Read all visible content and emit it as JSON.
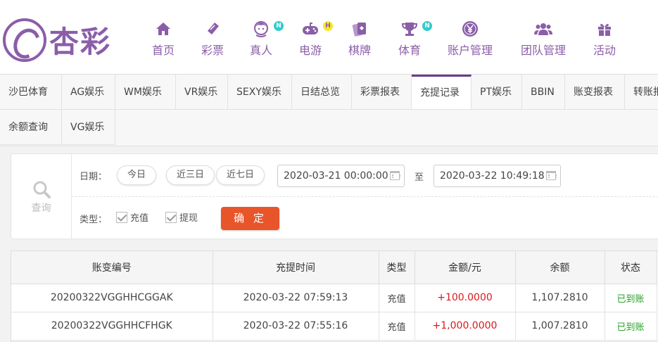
{
  "brand": {
    "name": "杏彩",
    "color": "#8b5ea8"
  },
  "nav": [
    {
      "label": "首页",
      "icon": "home-icon"
    },
    {
      "label": "彩票",
      "icon": "lottery-ticket-icon"
    },
    {
      "label": "真人",
      "icon": "live-dealer-icon",
      "badge": "N"
    },
    {
      "label": "电游",
      "icon": "gamepad-icon",
      "badge": "H"
    },
    {
      "label": "棋牌",
      "icon": "playing-cards-icon"
    },
    {
      "label": "体育",
      "icon": "trophy-icon",
      "badge": "N"
    },
    {
      "label": "账户管理",
      "icon": "account-yen-icon"
    },
    {
      "label": "团队管理",
      "icon": "team-icon"
    },
    {
      "label": "活动",
      "icon": "gift-icon"
    }
  ],
  "tabs_row1": [
    "沙巴体育",
    "AG娱乐",
    "WM娱乐",
    "VR娱乐",
    "SEXY娱乐",
    "日结总览",
    "彩票报表",
    "充提记录",
    "PT娱乐",
    "BBIN",
    "账变报表",
    "转账报"
  ],
  "tabs_row2": [
    "余额查询",
    "VG娱乐"
  ],
  "active_tab": "充提记录",
  "filter": {
    "query_label": "查询",
    "date_label": "日期：",
    "quick_ranges": [
      "今日",
      "近三日",
      "近七日"
    ],
    "start": "2020-03-21 00:00:00",
    "to": "至",
    "end": "2020-03-22 10:49:18",
    "type_label": "类型：",
    "types": [
      "充值",
      "提现"
    ],
    "confirm": "确 定"
  },
  "table": {
    "headers": [
      "账变编号",
      "充提时间",
      "类型",
      "金额/元",
      "余额",
      "状态"
    ],
    "rows": [
      {
        "id": "20200322VGGHHCGGAK",
        "time": "2020-03-22 07:59:13",
        "type": "充值",
        "amount": "+100.0000",
        "balance": "1,107.2810",
        "status": "已到账"
      },
      {
        "id": "20200322VGGHHCFHGK",
        "time": "2020-03-22 07:55:16",
        "type": "充值",
        "amount": "+1,000.0000",
        "balance": "1,007.2810",
        "status": "已到账"
      }
    ]
  },
  "colors": {
    "accent": "#8b5ea8",
    "confirm": "#e8552a",
    "amount": "#d8191f",
    "status": "#2aa02a",
    "tab_active_border": "#6d3a8e"
  }
}
